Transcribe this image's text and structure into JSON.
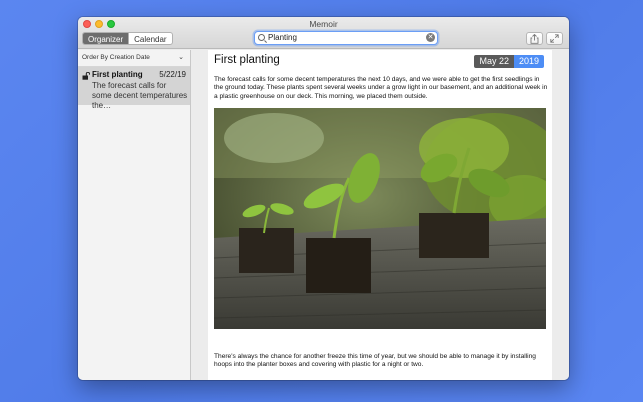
{
  "window": {
    "title": "Memoir"
  },
  "toolbar": {
    "tabs": [
      {
        "label": "Organizer"
      },
      {
        "label": "Calendar"
      }
    ],
    "search": {
      "value": "Planting",
      "clear_icon": "clear-circle-icon"
    },
    "share_icon": "share-icon",
    "fullscreen_icon": "fullscreen-icon"
  },
  "sidebar": {
    "sort_label": "Order By Creation Date",
    "items": [
      {
        "title": "First planting",
        "date": "5/22/19",
        "snippet": "The forecast calls for some decent temperatures the…",
        "icon": "unlock-icon"
      }
    ]
  },
  "entry": {
    "title": "First planting",
    "date_day": "May 22",
    "date_year": "2019",
    "para1": "The forecast calls for some decent temperatures the next 10 days, and we were able to get the first seedlings in the ground today. These plants spent several weeks under a grow light in our basement, and an additional week in a plastic greenhouse on our deck. This morning, we placed them outside.",
    "para2": "There's always the chance for another freeze this time of year, but we should be able to manage it by installing hoops into the planter boxes and covering with plastic for a night or two."
  },
  "colors": {
    "accent": "#4d8df5",
    "background": "#5b86f0"
  }
}
